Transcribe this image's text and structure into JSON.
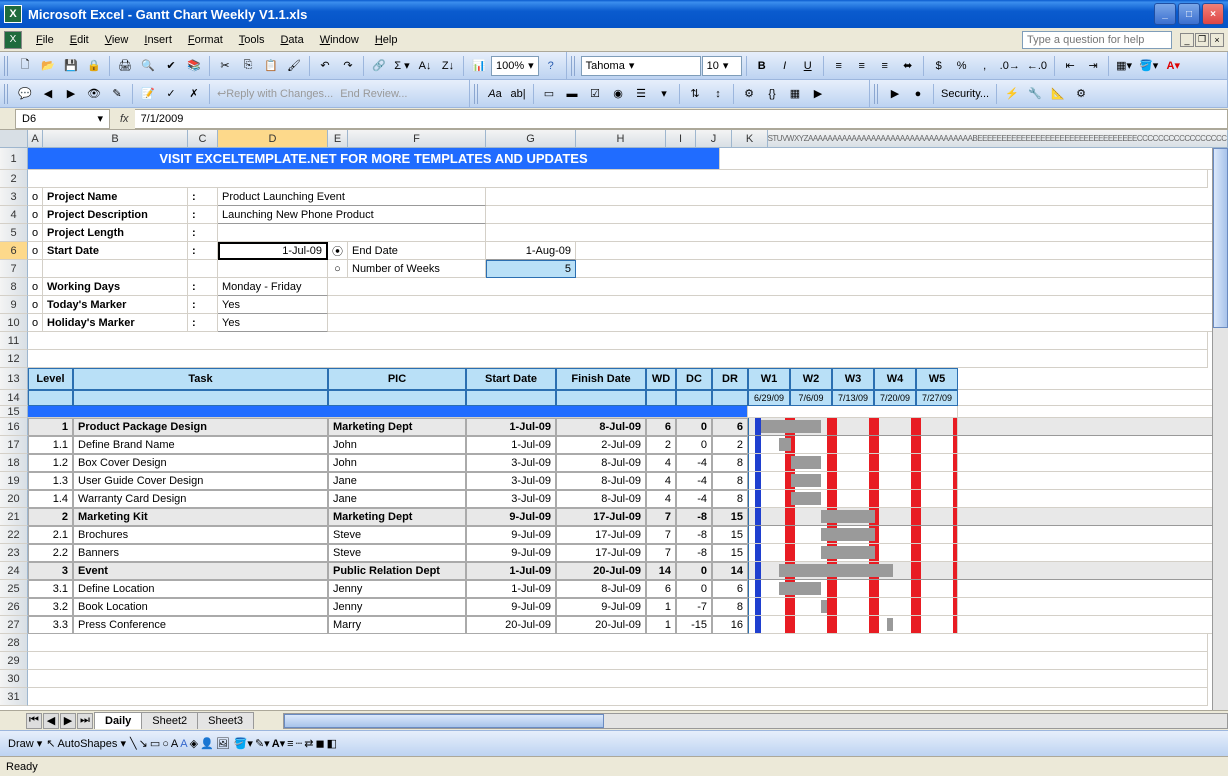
{
  "window": {
    "app": "Microsoft Excel",
    "doc": "Gantt Chart Weekly V1.1.xls"
  },
  "menu": [
    "File",
    "Edit",
    "View",
    "Insert",
    "Format",
    "Tools",
    "Data",
    "Window",
    "Help"
  ],
  "help_placeholder": "Type a question for help",
  "font": {
    "name": "Tahoma",
    "size": "10"
  },
  "zoom": "100%",
  "reply": "Reply with Changes...",
  "endrev": "End Review...",
  "security": "Security...",
  "namebox": "D6",
  "formula": "7/1/2009",
  "cols": [
    "A",
    "B",
    "C",
    "D",
    "E",
    "F",
    "G",
    "H",
    "I",
    "J",
    "K"
  ],
  "collapsed_cols": "LNNOPQRSTUVWXYZAAAAAAAAAAAAAAAAAAAAAAAAAAAAAAAAAABEEEEEEEEEEEEEEEEEEEEEEEEEEEEEEEEECCCCCCCCCCCCCCCCCCCCCCCC",
  "banner": "VISIT EXCELTEMPLATE.NET FOR MORE TEMPLATES AND UPDATES",
  "meta": {
    "pn_label": "Project Name",
    "pn_val": "Product Launching Event",
    "pd_label": "Project Description",
    "pd_val": "Launching New Phone Product",
    "pl_label": "Project Length",
    "sd_label": "Start Date",
    "sd_val": "1-Jul-09",
    "ed_label": "End Date",
    "ed_val": "1-Aug-09",
    "nw_label": "Number of Weeks",
    "nw_val": "5",
    "wd_label": "Working Days",
    "wd_val": "Monday - Friday",
    "tm_label": "Today's Marker",
    "tm_val": "Yes",
    "hm_label": "Holiday's Marker",
    "hm_val": "Yes"
  },
  "thead": {
    "level": "Level",
    "task": "Task",
    "pic": "PIC",
    "start": "Start Date",
    "finish": "Finish Date",
    "wd": "WD",
    "dc": "DC",
    "dr": "DR"
  },
  "weeks": [
    {
      "w": "W1",
      "d": "6/29/09"
    },
    {
      "w": "W2",
      "d": "7/6/09"
    },
    {
      "w": "W3",
      "d": "7/13/09"
    },
    {
      "w": "W4",
      "d": "7/20/09"
    },
    {
      "w": "W5",
      "d": "7/27/09"
    }
  ],
  "rows": [
    {
      "lvl": "1",
      "task": "Product Package Design",
      "pic": "Marketing Dept",
      "s": "1-Jul-09",
      "f": "8-Jul-09",
      "wd": "6",
      "dc": "0",
      "dr": "6",
      "grp": true,
      "bar": [
        0,
        60
      ]
    },
    {
      "lvl": "1.1",
      "task": "Define Brand Name",
      "pic": "John",
      "s": "1-Jul-09",
      "f": "2-Jul-09",
      "wd": "2",
      "dc": "0",
      "dr": "2",
      "bar": [
        18,
        30
      ]
    },
    {
      "lvl": "1.2",
      "task": "Box Cover Design",
      "pic": "John",
      "s": "3-Jul-09",
      "f": "8-Jul-09",
      "wd": "4",
      "dc": "-4",
      "dr": "8",
      "bar": [
        30,
        60
      ]
    },
    {
      "lvl": "1.3",
      "task": "User Guide Cover Design",
      "pic": "Jane",
      "s": "3-Jul-09",
      "f": "8-Jul-09",
      "wd": "4",
      "dc": "-4",
      "dr": "8",
      "bar": [
        30,
        60
      ]
    },
    {
      "lvl": "1.4",
      "task": "Warranty Card Design",
      "pic": "Jane",
      "s": "3-Jul-09",
      "f": "8-Jul-09",
      "wd": "4",
      "dc": "-4",
      "dr": "8",
      "bar": [
        30,
        60
      ]
    },
    {
      "lvl": "2",
      "task": "Marketing Kit",
      "pic": "Marketing Dept",
      "s": "9-Jul-09",
      "f": "17-Jul-09",
      "wd": "7",
      "dc": "-8",
      "dr": "15",
      "grp": true,
      "bar": [
        60,
        114
      ]
    },
    {
      "lvl": "2.1",
      "task": "Brochures",
      "pic": "Steve",
      "s": "9-Jul-09",
      "f": "17-Jul-09",
      "wd": "7",
      "dc": "-8",
      "dr": "15",
      "bar": [
        60,
        114
      ]
    },
    {
      "lvl": "2.2",
      "task": "Banners",
      "pic": "Steve",
      "s": "9-Jul-09",
      "f": "17-Jul-09",
      "wd": "7",
      "dc": "-8",
      "dr": "15",
      "bar": [
        60,
        114
      ]
    },
    {
      "lvl": "3",
      "task": "Event",
      "pic": "Public Relation Dept",
      "s": "1-Jul-09",
      "f": "20-Jul-09",
      "wd": "14",
      "dc": "0",
      "dr": "14",
      "grp": true,
      "bar": [
        18,
        132
      ]
    },
    {
      "lvl": "3.1",
      "task": "Define Location",
      "pic": "Jenny",
      "s": "1-Jul-09",
      "f": "8-Jul-09",
      "wd": "6",
      "dc": "0",
      "dr": "6",
      "bar": [
        18,
        60
      ]
    },
    {
      "lvl": "3.2",
      "task": "Book Location",
      "pic": "Jenny",
      "s": "9-Jul-09",
      "f": "9-Jul-09",
      "wd": "1",
      "dc": "-7",
      "dr": "8",
      "bar": [
        60,
        66
      ]
    },
    {
      "lvl": "3.3",
      "task": "Press Conference",
      "pic": "Marry",
      "s": "20-Jul-09",
      "f": "20-Jul-09",
      "wd": "1",
      "dc": "-15",
      "dr": "16",
      "bar": [
        126,
        132
      ]
    }
  ],
  "red_stripes": [
    36,
    78,
    120,
    162,
    204
  ],
  "blue_stripe": 6,
  "sheets": [
    "Daily",
    "Sheet2",
    "Sheet3"
  ],
  "draw": "Draw",
  "autoshapes": "AutoShapes",
  "status": "Ready"
}
